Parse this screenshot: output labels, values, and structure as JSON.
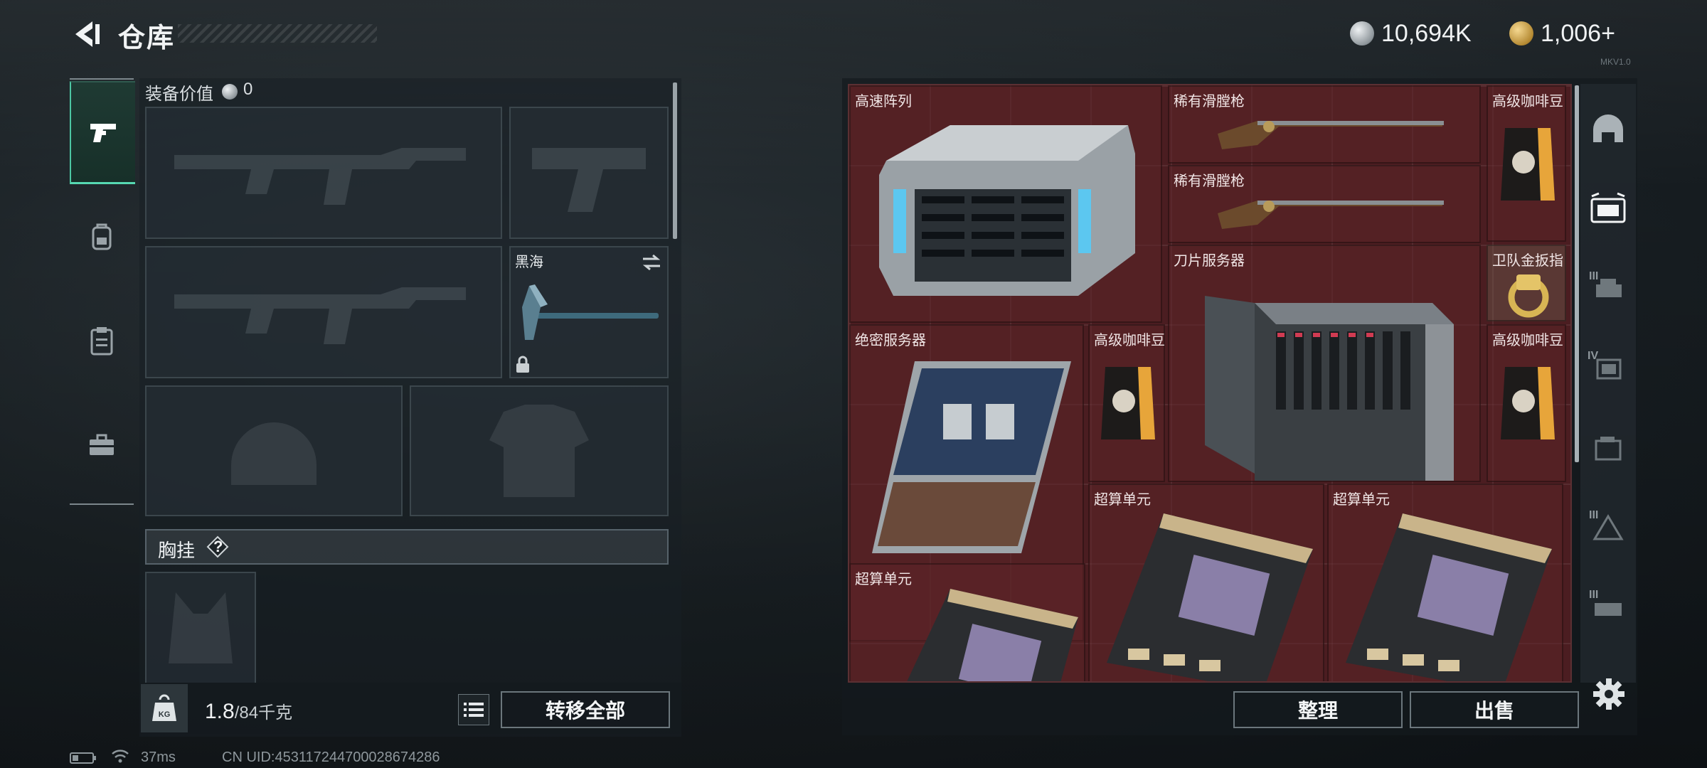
{
  "header": {
    "title": "仓库",
    "currencies": [
      {
        "icon": "silver-coin-icon",
        "value": "10,694K"
      },
      {
        "icon": "gold-coin-icon",
        "value": "1,006+"
      }
    ],
    "version_tag": "MKV1.0"
  },
  "left_tabs": [
    {
      "icon": "pistol-icon",
      "active": true
    },
    {
      "icon": "backpack-icon",
      "active": false
    },
    {
      "icon": "clipboard-icon",
      "active": false
    },
    {
      "icon": "toolbox-icon",
      "active": false
    }
  ],
  "equipment": {
    "value_label": "装备价值",
    "value": "0",
    "melee_slot": {
      "label": "黑海",
      "icons": [
        "swap-icon",
        "lock-icon",
        "pickaxe-icon"
      ]
    },
    "chest_rig_label": "胸挂",
    "chest_rig_help": "?"
  },
  "bottom_left": {
    "weight_current": "1.8",
    "weight_capacity": "/84千克",
    "weight_icon": "kg-weight-icon",
    "transfer_all_label": "转移全部"
  },
  "status_bar": {
    "ping": "37ms",
    "uid": "CN UID:453117244700028674286"
  },
  "stash_items": [
    {
      "name": "高速阵列",
      "icon": "storage-array-icon"
    },
    {
      "name": "稀有滑膛枪",
      "icon": "musket-icon"
    },
    {
      "name": "稀有滑膛枪",
      "icon": "musket-icon"
    },
    {
      "name": "高级咖啡豆",
      "icon": "coffee-bag-icon"
    },
    {
      "name": "卫队金扳指",
      "icon": "gold-ring-icon"
    },
    {
      "name": "刀片服务器",
      "icon": "blade-server-icon"
    },
    {
      "name": "绝密服务器",
      "icon": "server-board-icon"
    },
    {
      "name": "高级咖啡豆",
      "icon": "coffee-bag-icon"
    },
    {
      "name": "高级咖啡豆",
      "icon": "coffee-bag-icon"
    },
    {
      "name": "超算单元",
      "icon": "gpu-module-icon"
    },
    {
      "name": "超算单元",
      "icon": "gpu-module-icon"
    },
    {
      "name": "超算单元",
      "icon": "gpu-module-icon"
    }
  ],
  "right_tabs": [
    {
      "icon": "helmet-arch-icon"
    },
    {
      "icon": "chest-rig-tab-icon"
    },
    {
      "icon": "level-iii-icon",
      "label": "III"
    },
    {
      "icon": "level-iv-icon",
      "label": "IV"
    },
    {
      "icon": "stash-box-icon"
    },
    {
      "icon": "level-iii-triangle-icon",
      "label": "III"
    },
    {
      "icon": "level-iii-truck-icon",
      "label": "III"
    }
  ],
  "bottom_right": {
    "sort_label": "整理",
    "sell_label": "出售"
  }
}
